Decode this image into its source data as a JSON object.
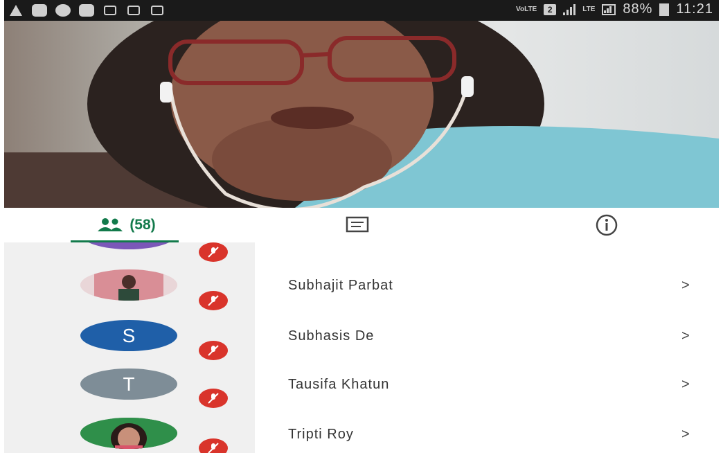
{
  "status_bar": {
    "network_label": "VoLTE",
    "sim_slot": "2",
    "lte_label": "LTE",
    "battery": "88%",
    "time": "11:21",
    "left_icons": [
      "warning-icon",
      "mail-icon",
      "chat-icon",
      "mail-icon",
      "email-icon",
      "image-icon",
      "app-icon"
    ]
  },
  "video": {
    "description_color": "#a9c3c7"
  },
  "tabs": {
    "people_count": "(58)",
    "people_icon": "people-icon",
    "chat_icon": "chat-icon",
    "info_icon": "info-icon",
    "active_color": "#127a4b"
  },
  "participants": [
    {
      "name": "",
      "avatar_type": "partial",
      "color": "#7b57b8"
    },
    {
      "name": "Subhajit Parbat",
      "avatar_type": "photo",
      "color": "#e7c9cf"
    },
    {
      "name": "Subhasis De",
      "avatar_type": "letter",
      "letter": "S",
      "color": "#1f5fa8"
    },
    {
      "name": "Tausifa Khatun",
      "avatar_type": "letter",
      "letter": "T",
      "color": "#7e8d97"
    },
    {
      "name": "Tripti Roy",
      "avatar_type": "photo",
      "color": "#2f8f4a"
    }
  ],
  "chevron": ">",
  "mute_color": "#d9342b"
}
